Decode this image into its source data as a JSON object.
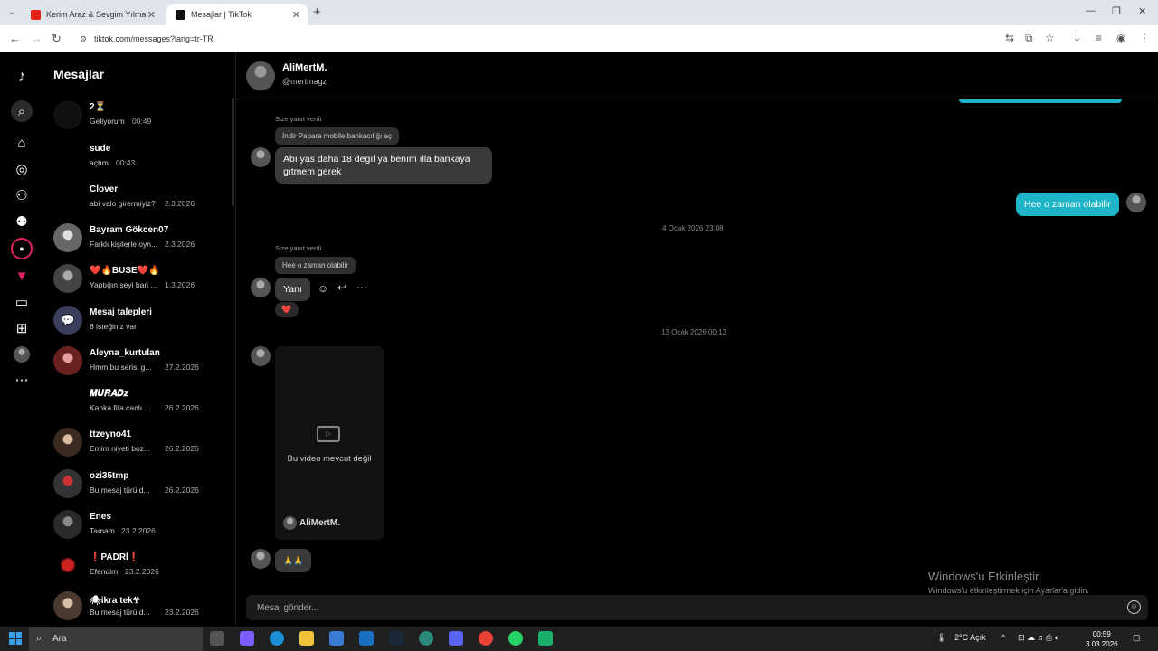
{
  "browser": {
    "tabs": [
      {
        "title": "Kerim Araz & Sevgim Yılmaz - D"
      },
      {
        "title": "Mesajlar | TikTok"
      }
    ],
    "url": "tiktok.com/messages?lang=tr-TR"
  },
  "sidebar": {
    "title": "Mesajlar",
    "conversations": [
      {
        "name": "2⏳",
        "preview": "Geliyorum",
        "time": "00:49"
      },
      {
        "name": "sude",
        "preview": "açtım",
        "time": "00:43"
      },
      {
        "name": "Clover",
        "preview": "abi valo girermiyiz?",
        "time": "2.3.2026"
      },
      {
        "name": "Bayram Gökcen07",
        "preview": "Farklı kişilerle oyn...",
        "time": "2.3.2026"
      },
      {
        "name": "❤️🔥BUSE❤️🔥",
        "preview": "Yaptığın şeyi bari ...",
        "time": "1.3.2026"
      },
      {
        "name": "Mesaj talepleri",
        "preview": "8 isteğiniz var",
        "time": ""
      },
      {
        "name": "Aleyna_kurtulan",
        "preview": "Hmm bu serisi g...",
        "time": "27.2.2026"
      },
      {
        "name": "𝑴𝑼𝑹𝑨𝑫𝒛",
        "preview": "Kanka fifa canlı ...",
        "time": "26.2.2026"
      },
      {
        "name": "ttzeyno41",
        "preview": "Emim niyeti boz...",
        "time": "26.2.2026"
      },
      {
        "name": "ozi35tmp",
        "preview": "Bu mesaj türü d...",
        "time": "26.2.2026"
      },
      {
        "name": "Enes",
        "preview": "Tamam",
        "time": "23.2.2026"
      },
      {
        "name": "❗PADRİ❗",
        "preview": "Efendim",
        "time": "23.2.2026"
      },
      {
        "name": "🕷ikra tek𖣂",
        "preview": "Bu mesaj türü d...",
        "time": "23.2.2026"
      }
    ]
  },
  "chat": {
    "name": "AliMertM.",
    "username": "@mertmagz",
    "reply_label_1": "Size yanıt verdi",
    "reply_quote_1": "İndir Papara mobile bankacılığı aç",
    "msg_1": "Abı yas daha 18 degıl ya benım ılla bankaya gıtmem gerek",
    "my_msg_1": "Hee o zaman olabilir",
    "date_1": "4 Ocak 2026 23:08",
    "reply_label_2": "Size yanıt verdi",
    "reply_quote_2": "Hee o zaman olabilir",
    "msg_2": "Yanı",
    "reaction": "❤️",
    "date_2": "13 Ocak 2026 00:13",
    "video_unavailable": "Bu video mevcut değil",
    "video_author": "AliMertM.",
    "msg_3": "🙏🙏",
    "input_placeholder": "Mesaj gönder..."
  },
  "watermark": {
    "title": "Windows'u Etkinleştir",
    "subtitle": "Windows'u etkinleştirmek için Ayarlar'a gidin."
  },
  "taskbar": {
    "search": "Ara",
    "weather": "2°C  Açık",
    "time": "00:59",
    "date": "3.03.2026"
  }
}
